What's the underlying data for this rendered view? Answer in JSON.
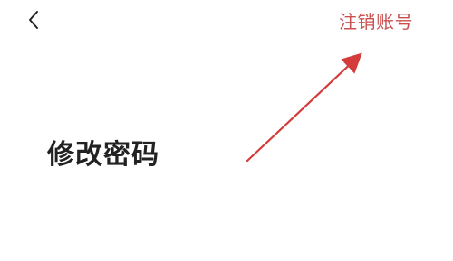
{
  "header": {
    "back_icon": "chevron-left-icon",
    "deregister_label": "注销账号",
    "accent_color": "#c9504f"
  },
  "annotation": {
    "title": "修改密码",
    "arrow_color": "#d43b3b"
  }
}
